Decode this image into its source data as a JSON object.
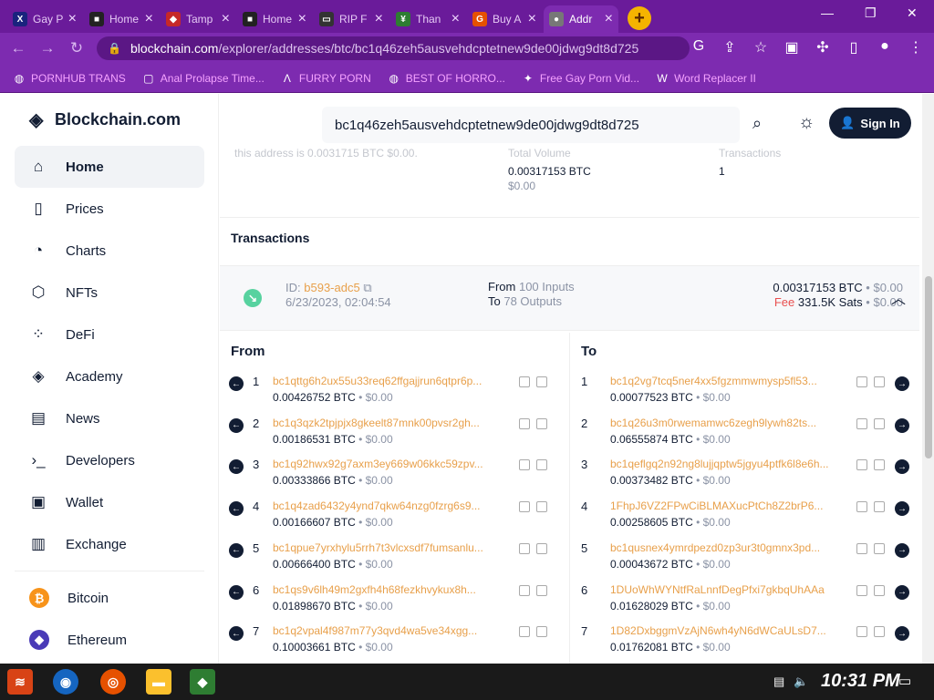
{
  "browser": {
    "tabs": [
      {
        "title": "Gay P",
        "color": "#1a237e",
        "glyph": "X"
      },
      {
        "title": "Home",
        "color": "#222",
        "glyph": "■"
      },
      {
        "title": "Tamp",
        "color": "#c62828",
        "glyph": "◆"
      },
      {
        "title": "Home",
        "color": "#222",
        "glyph": "■"
      },
      {
        "title": "RIP F",
        "color": "#333",
        "glyph": "▭"
      },
      {
        "title": "Than",
        "color": "#2e7d32",
        "glyph": "¥"
      },
      {
        "title": "Buy A",
        "color": "#e65100",
        "glyph": "G"
      },
      {
        "title": "Addr",
        "color": "#777",
        "glyph": "●"
      }
    ],
    "url_host": "blockchain.com",
    "url_path": "/explorer/addresses/btc/bc1q46zeh5ausvehdcptetnew9de00jdwg9dt8d725",
    "bookmarks": [
      {
        "label": "PORNHUB TRANS",
        "icon": "globe-icon"
      },
      {
        "label": "Anal Prolapse Time...",
        "icon": "bookmark-icon"
      },
      {
        "label": "FURRY PORN",
        "icon": "a-icon"
      },
      {
        "label": "BEST OF HORRO...",
        "icon": "globe-icon"
      },
      {
        "label": "Free Gay Porn Vid...",
        "icon": "fire-icon"
      },
      {
        "label": "Word Replacer II",
        "icon": "wr-icon"
      }
    ]
  },
  "site": {
    "brand": "Blockchain.com",
    "nav": [
      {
        "label": "Home",
        "icon": "home-icon",
        "glyph": "⌂",
        "active": true
      },
      {
        "label": "Prices",
        "icon": "prices-icon",
        "glyph": "▯",
        "active": false
      },
      {
        "label": "Charts",
        "icon": "charts-icon",
        "glyph": "◔",
        "active": false
      },
      {
        "label": "NFTs",
        "icon": "nft-icon",
        "glyph": "⬡",
        "active": false
      },
      {
        "label": "DeFi",
        "icon": "defi-icon",
        "glyph": "⁘",
        "active": false
      },
      {
        "label": "Academy",
        "icon": "academy-icon",
        "glyph": "◈",
        "active": false
      },
      {
        "label": "News",
        "icon": "news-icon",
        "glyph": "▤",
        "active": false
      },
      {
        "label": "Developers",
        "icon": "developers-icon",
        "glyph": "›_",
        "active": false
      },
      {
        "label": "Wallet",
        "icon": "wallet-icon",
        "glyph": "▣",
        "active": false
      },
      {
        "label": "Exchange",
        "icon": "exchange-icon",
        "glyph": "▥",
        "active": false
      }
    ],
    "coins": [
      {
        "label": "Bitcoin",
        "color": "#f7931a",
        "glyph": "₿"
      },
      {
        "label": "Ethereum",
        "color": "#4a3bb7",
        "glyph": "◆"
      }
    ],
    "search_value": "bc1q46zeh5ausvehdcptetnew9de00jdwg9dt8d725",
    "sign_in": "Sign In"
  },
  "stats": {
    "faded_text": "this address is 0.0031715 BTC $0.00.",
    "total_volume_label": "Total Volume",
    "total_volume": "0.00317153 BTC",
    "total_volume_usd": "$0.00",
    "transactions_label": "Transactions",
    "transactions": "1"
  },
  "transactions": {
    "heading": "Transactions",
    "id_label": "ID:",
    "id": "b593-adc5",
    "date": "6/23/2023, 02:04:54",
    "from_label": "From",
    "from_count": "100 Inputs",
    "to_label": "To",
    "to_count": "78 Outputs",
    "amount": "0.00317153 BTC",
    "amount_usd": "• $0.00",
    "fee_label": "Fee",
    "fee": "331.5K Sats",
    "fee_usd": "• $0.00"
  },
  "from_col": {
    "heading": "From",
    "rows": [
      {
        "n": "1",
        "addr": "bc1qttg6h2ux55u33req62ffgajjrun6qtpr6p...",
        "amt": "0.00426752 BTC",
        "usd": "• $0.00"
      },
      {
        "n": "2",
        "addr": "bc1q3qzk2tpjpjx8gkeelt87mnk00pvsr2gh...",
        "amt": "0.00186531 BTC",
        "usd": "• $0.00"
      },
      {
        "n": "3",
        "addr": "bc1q92hwx92g7axm3ey669w06kkc59zpv...",
        "amt": "0.00333866 BTC",
        "usd": "• $0.00"
      },
      {
        "n": "4",
        "addr": "bc1q4zad6432y4ynd7qkw64nzg0fzrg6s9...",
        "amt": "0.00166607 BTC",
        "usd": "• $0.00"
      },
      {
        "n": "5",
        "addr": "bc1qpue7yrxhylu5rrh7t3vlcxsdf7fumsanlu...",
        "amt": "0.00666400 BTC",
        "usd": "• $0.00"
      },
      {
        "n": "6",
        "addr": "bc1qs9v6lh49m2gxfh4h68fezkhvykux8h...",
        "amt": "0.01898670 BTC",
        "usd": "• $0.00"
      },
      {
        "n": "7",
        "addr": "bc1q2vpal4f987m77y3qvd4wa5ve34xgg...",
        "amt": "0.10003661 BTC",
        "usd": "• $0.00"
      }
    ]
  },
  "to_col": {
    "heading": "To",
    "rows": [
      {
        "n": "1",
        "addr": "bc1q2vg7tcq5ner4xx5fgzmmwmysp5fl53...",
        "amt": "0.00077523 BTC",
        "usd": "• $0.00"
      },
      {
        "n": "2",
        "addr": "bc1q26u3m0rwemamwc6zegh9lywh82ts...",
        "amt": "0.06555874 BTC",
        "usd": "• $0.00"
      },
      {
        "n": "3",
        "addr": "bc1qeflgq2n92ng8lujjqptw5jgyu4ptfk6l8e6h...",
        "amt": "0.00373482 BTC",
        "usd": "• $0.00"
      },
      {
        "n": "4",
        "addr": "1FhpJ6VZ2FPwCiBLMAXucPtCh8Z2brP6...",
        "amt": "0.00258605 BTC",
        "usd": "• $0.00"
      },
      {
        "n": "5",
        "addr": "bc1qusnex4ymrdpezd0zp3ur3t0gmnx3pd...",
        "amt": "0.00043672 BTC",
        "usd": "• $0.00"
      },
      {
        "n": "6",
        "addr": "1DUoWhWYNtfRaLnnfDegPfxi7gkbqUhAAa",
        "amt": "0.01628029 BTC",
        "usd": "• $0.00"
      },
      {
        "n": "7",
        "addr": "1D82DxbggmVzAjN6wh4yN6dWCaULsD7...",
        "amt": "0.01762081 BTC",
        "usd": "• $0.00"
      }
    ]
  },
  "taskbar": {
    "clock": "10:31 PM"
  }
}
